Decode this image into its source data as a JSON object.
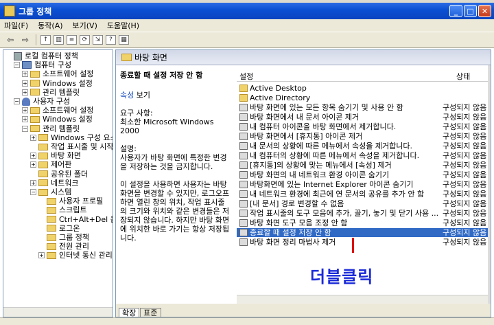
{
  "window": {
    "title": "그룹 정책"
  },
  "menu": [
    "파일(F)",
    "동작(A)",
    "보기(V)",
    "도움말(H)"
  ],
  "tree": [
    {
      "label": "로컬 컴퓨터 정책",
      "level": 0,
      "icon": "policy-icon",
      "exp": ""
    },
    {
      "label": "컴퓨터 구성",
      "level": 1,
      "icon": "computer-icon",
      "exp": "−"
    },
    {
      "label": "소프트웨어 설정",
      "level": 2,
      "icon": "folder-icon",
      "exp": "+"
    },
    {
      "label": "Windows 설정",
      "level": 2,
      "icon": "folder-icon",
      "exp": "+"
    },
    {
      "label": "관리 템플릿",
      "level": 2,
      "icon": "folder-icon",
      "exp": "+"
    },
    {
      "label": "사용자 구성",
      "level": 1,
      "icon": "user-icon",
      "exp": "−"
    },
    {
      "label": "소프트웨어 설정",
      "level": 2,
      "icon": "folder-icon",
      "exp": "+"
    },
    {
      "label": "Windows 설정",
      "level": 2,
      "icon": "folder-icon",
      "exp": "+"
    },
    {
      "label": "관리 템플릿",
      "level": 2,
      "icon": "folder-icon",
      "exp": "−"
    },
    {
      "label": "Windows 구성 요소",
      "level": 3,
      "icon": "folder-icon",
      "exp": "+"
    },
    {
      "label": "작업 표시줄 및 시작",
      "level": 3,
      "icon": "folder-icon",
      "exp": ""
    },
    {
      "label": "바탕 화면",
      "level": 3,
      "icon": "folder-icon",
      "exp": "+"
    },
    {
      "label": "제어판",
      "level": 3,
      "icon": "folder-icon",
      "exp": "+"
    },
    {
      "label": "공유된 폴더",
      "level": 3,
      "icon": "folder-icon",
      "exp": ""
    },
    {
      "label": "네트워크",
      "level": 3,
      "icon": "folder-icon",
      "exp": "+"
    },
    {
      "label": "시스템",
      "level": 3,
      "icon": "folder-icon",
      "exp": "−"
    },
    {
      "label": "사용자 프로필",
      "level": 4,
      "icon": "folder-icon",
      "exp": ""
    },
    {
      "label": "스크립트",
      "level": 4,
      "icon": "folder-icon",
      "exp": ""
    },
    {
      "label": "Ctrl+Alt+Del 옵션",
      "level": 4,
      "icon": "folder-icon",
      "exp": ""
    },
    {
      "label": "로그온",
      "level": 4,
      "icon": "folder-icon",
      "exp": ""
    },
    {
      "label": "그룹 정책",
      "level": 4,
      "icon": "folder-icon",
      "exp": ""
    },
    {
      "label": "전원 관리",
      "level": 4,
      "icon": "folder-icon",
      "exp": ""
    },
    {
      "label": "인터넷 통신 관리",
      "level": 4,
      "icon": "folder-icon",
      "exp": "+"
    }
  ],
  "right": {
    "header": "바탕 화면",
    "desc": {
      "name": "종료할 때 설정 저장 안 함",
      "view_link": "속성",
      "view_rest": " 보기",
      "req_label": "요구 사항:",
      "req_text": "최소한 Microsoft Windows 2000",
      "expl_label": "설명:",
      "expl_text": "사용자가 바탕 화면에 특정한 변경을 저장하는 것을 금지합니다.",
      "expl_more": "이 설정을 사용하면 사용자는 바탕 화면을 변경할 수 있지만, 로그오프하면 열린 창의 위치, 작업 표시줄의 크기와 위치와 같은 변경들은 저장되지 않습니다. 하지만 바탕 화면에 위치한 바로 가기는 항상 저장됩니다."
    },
    "columns": {
      "setting": "설정",
      "state": "상태"
    },
    "rows": [
      {
        "name": "Active Desktop",
        "state": "",
        "folder": true
      },
      {
        "name": "Active Directory",
        "state": "",
        "folder": true
      },
      {
        "name": "바탕 화면에 있는 모든 항목 숨기기 및 사용 안 함",
        "state": "구성되지 않음"
      },
      {
        "name": "바탕 화면에서 내 문서 아이콘 제거",
        "state": "구성되지 않음"
      },
      {
        "name": "내 컴퓨터 아이콘을 바탕 화면에서 제거합니다.",
        "state": "구성되지 않음"
      },
      {
        "name": "바탕 화면에서 [휴지통] 아이콘 제거",
        "state": "구성되지 않음"
      },
      {
        "name": "내 문서의 상황에 따른 메뉴에서 속성을 제거합니다.",
        "state": "구성되지 않음"
      },
      {
        "name": "내 컴퓨터의 상황에 따른 메뉴에서 속성을 제거합니다.",
        "state": "구성되지 않음"
      },
      {
        "name": "[휴지통]의 상황에 맞는 메뉴에서 [속성] 제거",
        "state": "구성되지 않음"
      },
      {
        "name": "바탕 화면의 내 네트워크 환경 아이콘 숨기기",
        "state": "구성되지 않음"
      },
      {
        "name": "바탕화면에 있는 Internet Explorer 아이콘 숨기기",
        "state": "구성되지 않음"
      },
      {
        "name": "내 네트워크 환경에 최근에 연 문서의 공유를 추가 안 함",
        "state": "구성되지 않음"
      },
      {
        "name": "[내 문서] 경로 변경할 수 없음",
        "state": "구성되지 않음"
      },
      {
        "name": "작업 표시줄의 도구 모음에 추가, 끌기, 놓기 및 닫기 사용 ...",
        "state": "구성되지 않음"
      },
      {
        "name": "바탕 화면 도구 모음 조정 안 함",
        "state": "구성되지 않음"
      },
      {
        "name": "종료할 때 설정 저장 안 함",
        "state": "구성되지 않음",
        "selected": true
      },
      {
        "name": "바탕 화면 정리 마법사 제거",
        "state": "구성되지 않음"
      }
    ],
    "tabs": [
      "확장",
      "표준"
    ]
  },
  "annotation": "더블클릭",
  "colors": {
    "title_bar": "#0a4fd2",
    "selection": "#316ac5",
    "annotation": "#1a2ad8"
  }
}
